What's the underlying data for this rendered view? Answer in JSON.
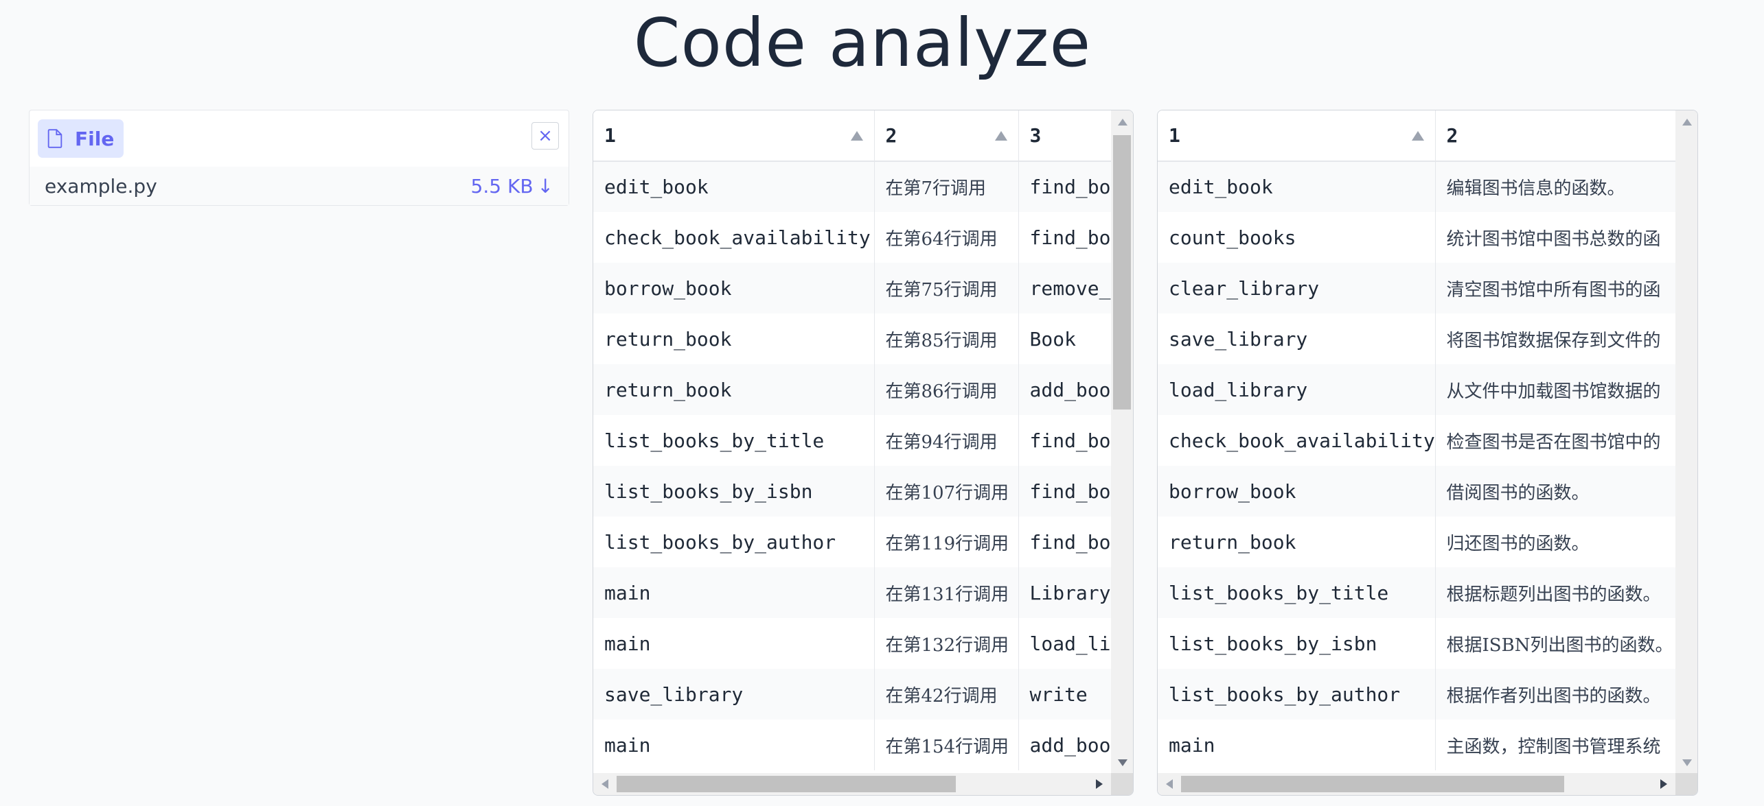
{
  "title": "Code analyze",
  "file_panel": {
    "label": "File",
    "file_name": "example.py",
    "file_size": "5.5 KB",
    "download_glyph": "↓",
    "clear_glyph": "×"
  },
  "calls_table": {
    "headers": [
      "1",
      "2",
      "3"
    ],
    "rows": [
      [
        "edit_book",
        "在第7行调用",
        "find_bo"
      ],
      [
        "check_book_availability",
        "在第64行调用",
        "find_bo"
      ],
      [
        "borrow_book",
        "在第75行调用",
        "remove_"
      ],
      [
        "return_book",
        "在第85行调用",
        "Book"
      ],
      [
        "return_book",
        "在第86行调用",
        "add_boo"
      ],
      [
        "list_books_by_title",
        "在第94行调用",
        "find_bo"
      ],
      [
        "list_books_by_isbn",
        "在第107行调用",
        "find_bo"
      ],
      [
        "list_books_by_author",
        "在第119行调用",
        "find_bo"
      ],
      [
        "main",
        "在第131行调用",
        "Library"
      ],
      [
        "main",
        "在第132行调用",
        "load_li"
      ],
      [
        "save_library",
        "在第42行调用",
        "write"
      ],
      [
        "main",
        "在第154行调用",
        "add_boo"
      ]
    ]
  },
  "desc_table": {
    "headers": [
      "1",
      "2"
    ],
    "rows": [
      [
        "edit_book",
        "编辑图书信息的函数。"
      ],
      [
        "count_books",
        "统计图书馆中图书总数的函"
      ],
      [
        "clear_library",
        "清空图书馆中所有图书的函"
      ],
      [
        "save_library",
        "将图书馆数据保存到文件的"
      ],
      [
        "load_library",
        "从文件中加载图书馆数据的"
      ],
      [
        "check_book_availability",
        "检查图书是否在图书馆中的"
      ],
      [
        "borrow_book",
        "借阅图书的函数。"
      ],
      [
        "return_book",
        "归还图书的函数。"
      ],
      [
        "list_books_by_title",
        "根据标题列出图书的函数。"
      ],
      [
        "list_books_by_isbn",
        "根据ISBN列出图书的函数。"
      ],
      [
        "list_books_by_author",
        "根据作者列出图书的函数。"
      ],
      [
        "main",
        "主函数，控制图书管理系统"
      ]
    ]
  }
}
